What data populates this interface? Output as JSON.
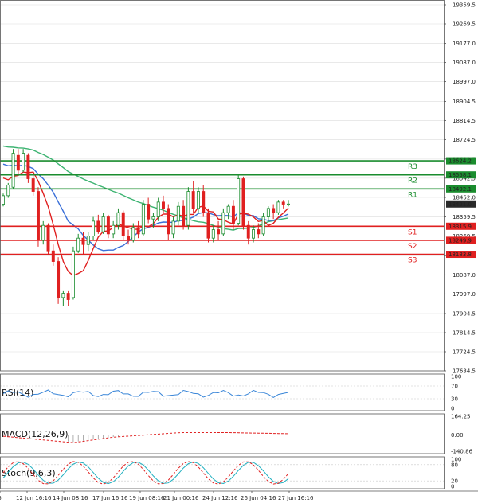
{
  "chart_data": {
    "type": "candlestick",
    "price_axis": {
      "ticks": [
        "19359.5",
        "19269.5",
        "19177.0",
        "19087.0",
        "18997.0",
        "18904.5",
        "18814.5",
        "18724.5",
        "18632.5",
        "18542.5",
        "18452.0",
        "18359.5",
        "18269.5",
        "18177.5",
        "18087.0",
        "17997.0",
        "17904.5",
        "17814.5",
        "17724.5",
        "17634.5"
      ],
      "range": [
        17634.5,
        19359.5
      ]
    },
    "time_axis": {
      "ticks": [
        "4:16",
        "12 Jun 16:16",
        "14 Jun 08:16",
        "17 Jun 16:16",
        "19 Jun 08:16",
        "21 Jun 00:16",
        "24 Jun 12:16",
        "26 Jun 04:16",
        "27 Jun 16:16"
      ]
    },
    "current_price": "18421.0",
    "levels": [
      {
        "label": "R3",
        "value": "18624.2",
        "color": "#1a8c2e"
      },
      {
        "label": "R2",
        "value": "18558.1",
        "color": "#1a8c2e"
      },
      {
        "label": "R1",
        "value": "18492.1",
        "color": "#1a8c2e"
      },
      {
        "label": "S1",
        "value": "18315.9",
        "color": "#e02020"
      },
      {
        "label": "S2",
        "value": "18249.9",
        "color": "#e02020"
      },
      {
        "label": "S3",
        "value": "18183.8",
        "color": "#e02020"
      }
    ],
    "candles": [
      {
        "o": 18420,
        "h": 18470,
        "l": 18410,
        "c": 18460
      },
      {
        "o": 18460,
        "h": 18520,
        "l": 18450,
        "c": 18510
      },
      {
        "o": 18500,
        "h": 18680,
        "l": 18490,
        "c": 18660
      },
      {
        "o": 18650,
        "h": 18680,
        "l": 18560,
        "c": 18580
      },
      {
        "o": 18580,
        "h": 18680,
        "l": 18570,
        "c": 18660
      },
      {
        "o": 18650,
        "h": 18660,
        "l": 18520,
        "c": 18540
      },
      {
        "o": 18540,
        "h": 18560,
        "l": 18460,
        "c": 18480
      },
      {
        "o": 18480,
        "h": 18500,
        "l": 18220,
        "c": 18250
      },
      {
        "o": 18250,
        "h": 18340,
        "l": 18230,
        "c": 18320
      },
      {
        "o": 18320,
        "h": 18330,
        "l": 18180,
        "c": 18200
      },
      {
        "o": 18200,
        "h": 18230,
        "l": 18130,
        "c": 18150
      },
      {
        "o": 18150,
        "h": 18170,
        "l": 17950,
        "c": 17980
      },
      {
        "o": 17980,
        "h": 18010,
        "l": 17940,
        "c": 18000
      },
      {
        "o": 18000,
        "h": 18010,
        "l": 17940,
        "c": 17970
      },
      {
        "o": 17980,
        "h": 18220,
        "l": 17970,
        "c": 18200
      },
      {
        "o": 18200,
        "h": 18280,
        "l": 18190,
        "c": 18260
      },
      {
        "o": 18260,
        "h": 18290,
        "l": 18180,
        "c": 18230
      },
      {
        "o": 18230,
        "h": 18290,
        "l": 18200,
        "c": 18270
      },
      {
        "o": 18270,
        "h": 18360,
        "l": 18250,
        "c": 18340
      },
      {
        "o": 18340,
        "h": 18370,
        "l": 18280,
        "c": 18290
      },
      {
        "o": 18290,
        "h": 18380,
        "l": 18280,
        "c": 18360
      },
      {
        "o": 18360,
        "h": 18370,
        "l": 18260,
        "c": 18280
      },
      {
        "o": 18280,
        "h": 18340,
        "l": 18260,
        "c": 18320
      },
      {
        "o": 18320,
        "h": 18400,
        "l": 18300,
        "c": 18380
      },
      {
        "o": 18380,
        "h": 18390,
        "l": 18250,
        "c": 18270
      },
      {
        "o": 18270,
        "h": 18300,
        "l": 18230,
        "c": 18250
      },
      {
        "o": 18250,
        "h": 18330,
        "l": 18240,
        "c": 18310
      },
      {
        "o": 18310,
        "h": 18340,
        "l": 18260,
        "c": 18280
      },
      {
        "o": 18280,
        "h": 18440,
        "l": 18270,
        "c": 18420
      },
      {
        "o": 18420,
        "h": 18450,
        "l": 18330,
        "c": 18350
      },
      {
        "o": 18350,
        "h": 18380,
        "l": 18310,
        "c": 18360
      },
      {
        "o": 18360,
        "h": 18450,
        "l": 18340,
        "c": 18430
      },
      {
        "o": 18430,
        "h": 18460,
        "l": 18380,
        "c": 18400
      },
      {
        "o": 18400,
        "h": 18420,
        "l": 18250,
        "c": 18280
      },
      {
        "o": 18280,
        "h": 18360,
        "l": 18260,
        "c": 18340
      },
      {
        "o": 18340,
        "h": 18430,
        "l": 18320,
        "c": 18410
      },
      {
        "o": 18410,
        "h": 18440,
        "l": 18300,
        "c": 18320
      },
      {
        "o": 18320,
        "h": 18500,
        "l": 18300,
        "c": 18480
      },
      {
        "o": 18480,
        "h": 18530,
        "l": 18380,
        "c": 18400
      },
      {
        "o": 18400,
        "h": 18500,
        "l": 18380,
        "c": 18480
      },
      {
        "o": 18480,
        "h": 18510,
        "l": 18360,
        "c": 18380
      },
      {
        "o": 18380,
        "h": 18400,
        "l": 18240,
        "c": 18260
      },
      {
        "o": 18260,
        "h": 18320,
        "l": 18240,
        "c": 18300
      },
      {
        "o": 18300,
        "h": 18340,
        "l": 18250,
        "c": 18280
      },
      {
        "o": 18280,
        "h": 18400,
        "l": 18270,
        "c": 18380
      },
      {
        "o": 18380,
        "h": 18420,
        "l": 18350,
        "c": 18410
      },
      {
        "o": 18410,
        "h": 18440,
        "l": 18300,
        "c": 18330
      },
      {
        "o": 18330,
        "h": 18560,
        "l": 18320,
        "c": 18540
      },
      {
        "o": 18540,
        "h": 18550,
        "l": 18300,
        "c": 18320
      },
      {
        "o": 18320,
        "h": 18340,
        "l": 18230,
        "c": 18260
      },
      {
        "o": 18260,
        "h": 18320,
        "l": 18240,
        "c": 18300
      },
      {
        "o": 18300,
        "h": 18330,
        "l": 18260,
        "c": 18280
      },
      {
        "o": 18280,
        "h": 18380,
        "l": 18270,
        "c": 18360
      },
      {
        "o": 18360,
        "h": 18410,
        "l": 18340,
        "c": 18400
      },
      {
        "o": 18400,
        "h": 18420,
        "l": 18350,
        "c": 18380
      },
      {
        "o": 18380,
        "h": 18440,
        "l": 18370,
        "c": 18430
      },
      {
        "o": 18430,
        "h": 18440,
        "l": 18400,
        "c": 18420
      },
      {
        "o": 18420,
        "h": 18440,
        "l": 18410,
        "c": 18421
      }
    ],
    "indicators": [
      {
        "name": "RSI(14)",
        "ticks": [
          "100",
          "70",
          "30",
          "0"
        ]
      },
      {
        "name": "MACD(12,26,9)",
        "ticks": [
          "164.25",
          "0.00",
          "-140.86"
        ]
      },
      {
        "name": "Stoch(9,6,3)",
        "ticks": [
          "100",
          "80",
          "20",
          "0"
        ]
      }
    ],
    "colors": {
      "up": "#1a8c2e",
      "down": "#e02020",
      "ma_fast": "#e02020",
      "ma_mid": "#3a6fd8",
      "ma_slow": "#3cb371",
      "rsi": "#3a86d8",
      "macd": "#e02020",
      "macd_hist": "#999999",
      "stoch_k": "#e02020",
      "stoch_d": "#20b0c0"
    }
  }
}
